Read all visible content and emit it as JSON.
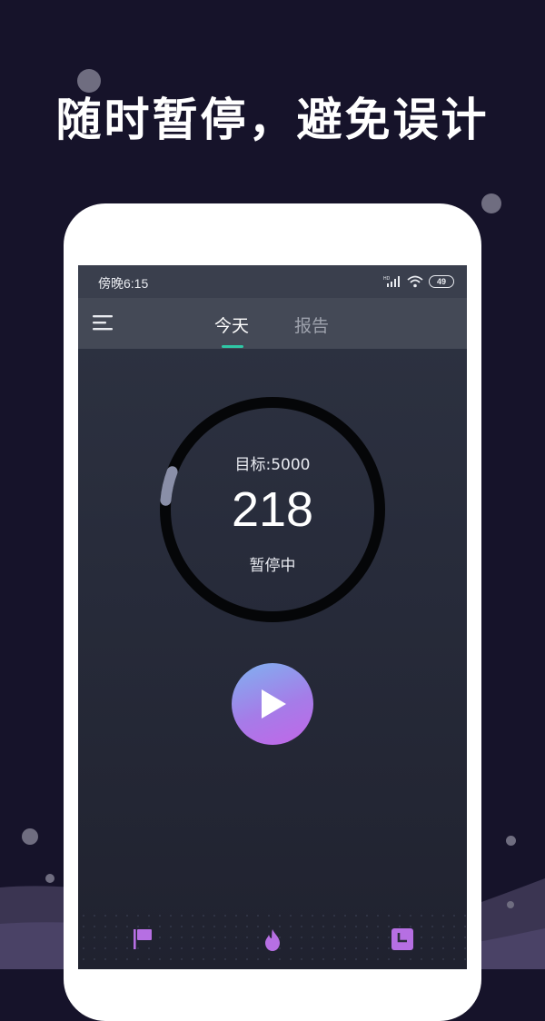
{
  "headline": "随时暂停，避免误计",
  "status_bar": {
    "time": "傍晚6:15",
    "network_label": "HD",
    "battery": "49"
  },
  "tabs": [
    {
      "label": "今天",
      "active": true
    },
    {
      "label": "报告",
      "active": false
    }
  ],
  "counter": {
    "goal_label": "目标:5000",
    "steps": "218",
    "state": "暂停中",
    "progress_fraction": 0.0436
  },
  "bottom_nav": [
    {
      "icon": "flag-icon"
    },
    {
      "icon": "flame-icon"
    },
    {
      "icon": "clock-icon"
    }
  ],
  "colors": {
    "accent": "#2fc7a5",
    "nav_icon": "#b66fe3",
    "play_gradient_start": "#7fb2f0",
    "play_gradient_end": "#c266e8"
  }
}
